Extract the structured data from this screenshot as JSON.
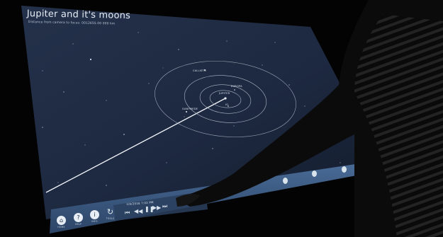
{
  "header": {
    "title": "Jupiter and it's moons",
    "subtitle": "Distance from camera to focus: 0012655.00 000 km"
  },
  "moons": [
    {
      "label": "Callisto"
    },
    {
      "label": "Ganymede"
    },
    {
      "label": "Jupiter"
    },
    {
      "label": "Europa"
    },
    {
      "label": "Io"
    }
  ],
  "toolbar": {
    "buttons": [
      {
        "label": "Home",
        "icon": "home-icon"
      },
      {
        "label": "Help",
        "icon": "help-icon"
      },
      {
        "label": "Info",
        "icon": "info-icon"
      },
      {
        "label": "Tools",
        "icon": "tools-icon"
      }
    ],
    "datetime": "1/9/2018 7:02 PM"
  },
  "colors": {
    "sky": "#1f2b40",
    "toolbar": "#3c5d86",
    "accent": "#e6edf4"
  }
}
